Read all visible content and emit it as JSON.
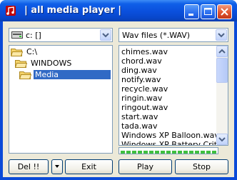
{
  "window": {
    "title": "| all media player |"
  },
  "drive": {
    "value": "c: []"
  },
  "filter": {
    "value": "Wav files (*.WAV)"
  },
  "tree": [
    {
      "label": "C:\\",
      "selected": false
    },
    {
      "label": "WINDOWS",
      "selected": false
    },
    {
      "label": "Media",
      "selected": true
    }
  ],
  "files": [
    "chimes.wav",
    "chord.wav",
    "ding.wav",
    "notify.wav",
    "recycle.wav",
    "ringin.wav",
    "ringout.wav",
    "start.wav",
    "tada.wav",
    "Windows XP Balloon.wav",
    "Windows XP Battery Critica"
  ],
  "buttons": {
    "del": "Del !!",
    "exit": "Exit",
    "play": "Play",
    "stop": "Stop"
  },
  "icons": {
    "app": "music-note-icon",
    "minimize": "minimize-icon",
    "maximize": "maximize-icon",
    "close": "close-icon",
    "drive": "drive-icon",
    "folder": "folder-icon",
    "open_folder": "open-folder-icon",
    "dropdown": "chevron-down-icon"
  },
  "colors": {
    "titlebar": "#0a4fdc",
    "selection": "#316ac5",
    "progress": "#3fbf3f",
    "close_button": "#e1552e"
  }
}
